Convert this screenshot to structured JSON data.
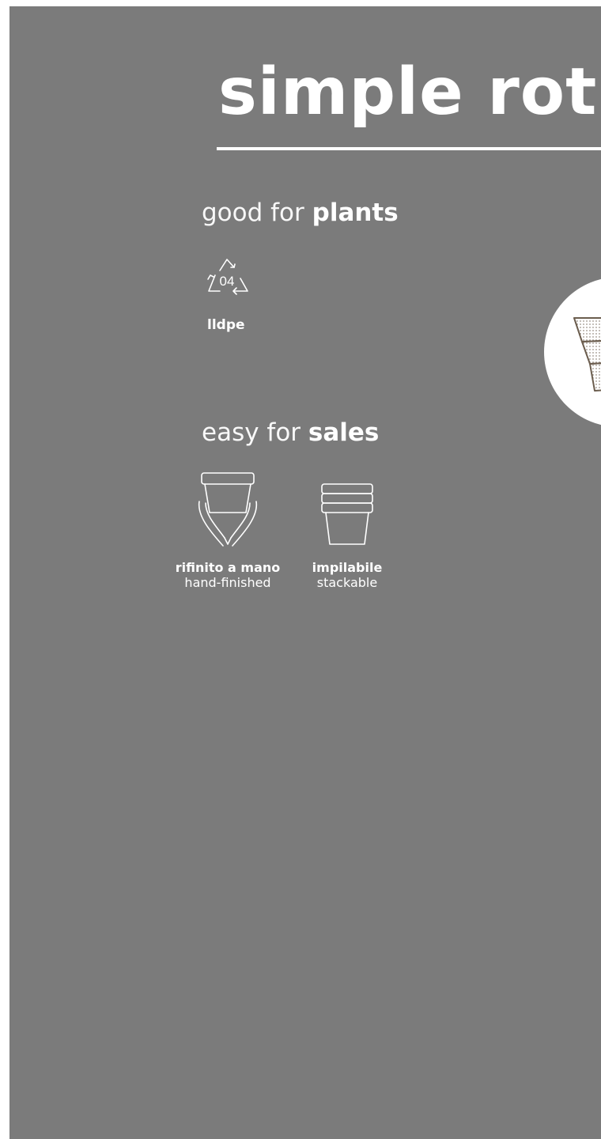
{
  "header": {
    "title": "simple rot"
  },
  "section_plants": {
    "title_light": "good for ",
    "title_bold": "plants",
    "recycle": {
      "code": "04",
      "label": "lldpe",
      "icon": "recycle-icon"
    }
  },
  "section_sales": {
    "title_light": "easy for ",
    "title_bold": "sales",
    "features": [
      {
        "label_it": "rifinito a mano",
        "label_en": "hand-finished",
        "icon": "hands-holding-pot-icon"
      },
      {
        "label_it": "impilabile",
        "label_en": "stackable",
        "icon": "stacked-pots-icon"
      }
    ]
  },
  "product": {
    "icon": "stacked-pots-product-image"
  },
  "colors": {
    "background": "#7b7b7b",
    "foreground": "#ffffff",
    "page": "#ffffff",
    "product_outline": "#6b5d4e"
  }
}
